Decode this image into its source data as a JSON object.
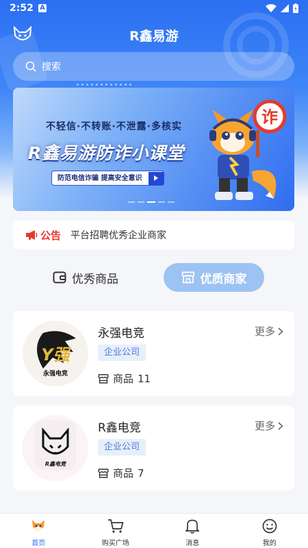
{
  "status_bar": {
    "time": "2:52",
    "notif_letter": "A"
  },
  "header": {
    "title": "R鑫易游"
  },
  "search": {
    "placeholder": "搜索"
  },
  "banner": {
    "slogan": "不轻信·不转账·不泄露·多核实",
    "title": "R鑫易游防诈小课堂",
    "tagline": "防范电信诈骗  提高安全意识",
    "badge": "诈"
  },
  "notice": {
    "label": "公告",
    "text": "平台招聘优秀企业商家"
  },
  "tabs": [
    {
      "label": "优秀商品",
      "active": false
    },
    {
      "label": "优质商家",
      "active": true
    }
  ],
  "merchants": [
    {
      "name": "永强电竞",
      "more": "更多",
      "tag": "企业公司",
      "goods_label": "商品",
      "goods_count": "11",
      "logo_text": "永强电竞",
      "logo_mark": "Y强"
    },
    {
      "name": "R鑫电竞",
      "more": "更多",
      "tag": "企业公司",
      "goods_label": "商品",
      "goods_count": "7",
      "logo_text": "R鑫电竞"
    }
  ],
  "bottom_nav": [
    {
      "label": "首页",
      "icon": "fox-home-icon",
      "active": true
    },
    {
      "label": "购买广场",
      "icon": "cart-icon",
      "active": false
    },
    {
      "label": "消息",
      "icon": "bell-icon",
      "active": false
    },
    {
      "label": "我的",
      "icon": "smile-icon",
      "active": false
    }
  ],
  "colors": {
    "primary": "#2f6df0",
    "notice_red": "#e5392f",
    "tab_active_bg": "#9dc3f3",
    "tag_bg": "#e7effb"
  }
}
